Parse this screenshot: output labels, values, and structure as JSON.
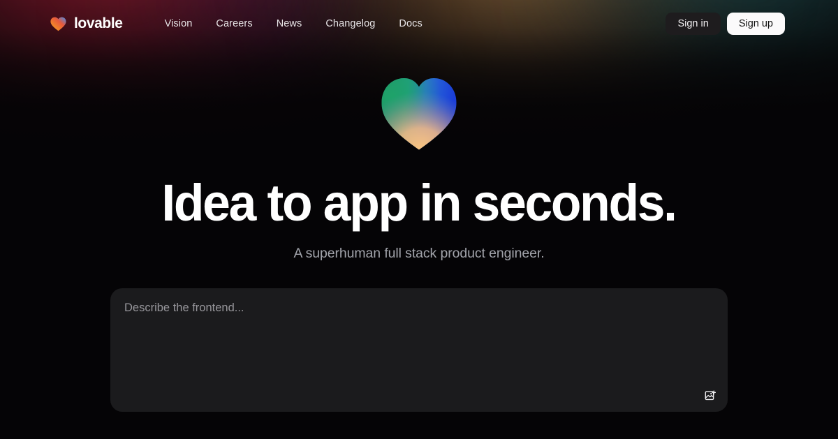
{
  "brand": {
    "name": "lovable",
    "logo_icon": "heart-gradient-icon",
    "logo_gradient": [
      "#f59e2c",
      "#ef5a35",
      "#3b82f6"
    ]
  },
  "nav": {
    "items": [
      {
        "label": "Vision",
        "name": "nav-link-vision"
      },
      {
        "label": "Careers",
        "name": "nav-link-careers"
      },
      {
        "label": "News",
        "name": "nav-link-news"
      },
      {
        "label": "Changelog",
        "name": "nav-link-changelog"
      },
      {
        "label": "Docs",
        "name": "nav-link-docs"
      }
    ]
  },
  "header_actions": {
    "sign_in_label": "Sign in",
    "sign_up_label": "Sign up",
    "sign_in_bg": "#1e1c1e",
    "sign_up_bg": "#fbfafb"
  },
  "hero": {
    "heart_icon": "heart-gradient-large-icon",
    "heart_gradient": [
      "#2f9e6e",
      "#1f6ee0",
      "#f3b770"
    ],
    "title": "Idea to app in seconds.",
    "subtitle": "A superhuman full stack product engineer."
  },
  "prompt": {
    "placeholder": "Describe the frontend...",
    "value": "",
    "attach_image_icon": "image-upload-icon",
    "panel_bg": "#1b1b1d"
  },
  "theme": {
    "page_bg": "#050406",
    "text_primary": "#ffffff",
    "text_muted": "#a2a4ab",
    "glow_crimson": "#961c30",
    "glow_amber": "#ce985c",
    "glow_teal": "#2e6e70"
  }
}
